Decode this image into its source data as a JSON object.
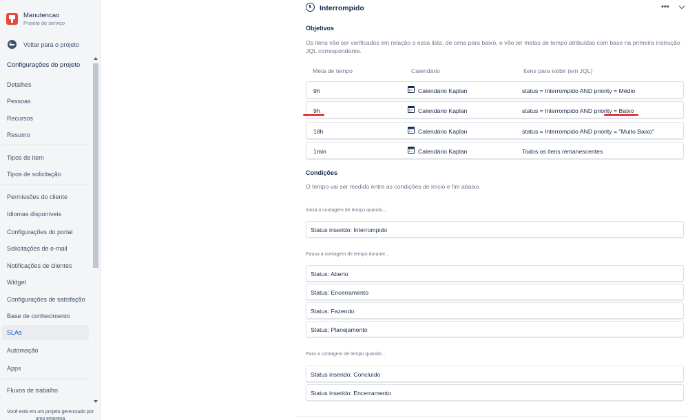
{
  "sidebar": {
    "project_name": "Manutencao",
    "project_type": "Projeto de serviço",
    "back_label": "Voltar para o projeto",
    "section_title": "Configurações do projeto",
    "items": [
      {
        "label": "Detalhes"
      },
      {
        "label": "Pessoas"
      },
      {
        "label": "Recursos"
      },
      {
        "label": "Resumo"
      },
      {
        "label": "Tipos de item"
      },
      {
        "label": "Tipos de solicitação"
      },
      {
        "label": "Permissões do cliente"
      },
      {
        "label": "Idiomas disponíveis"
      },
      {
        "label": "Configurações do portal"
      },
      {
        "label": "Solicitações de e-mail"
      },
      {
        "label": "Notificações de clientes"
      },
      {
        "label": "Widget"
      },
      {
        "label": "Configurações de satisfação"
      },
      {
        "label": "Base de conhecimento"
      },
      {
        "label": "SLAs"
      },
      {
        "label": "Automação"
      },
      {
        "label": "Apps"
      },
      {
        "label": "Fluxos de trabalho"
      }
    ],
    "selected": "SLAs",
    "footer": "Você está em um projeto gerenciado por uma empresa"
  },
  "sla": {
    "name": "Interrompido",
    "goals_title": "Objetivos",
    "goals_description": "Os itens vão ser verificados em relação a essa lista, de cima para baixo, e vão ter metas de tempo atribuídas com base na primeira instrução JQL correspondente.",
    "columns": {
      "goal": "Meta de tempo",
      "calendar": "Calendário",
      "jql": "Itens para exibir (em JQL)"
    },
    "goals": [
      {
        "goal": "9h",
        "calendar": "Calendário Kaplan",
        "jql": "status = Interrompido AND priority = Médio"
      },
      {
        "goal": "9h",
        "calendar": "Calendário Kaplan",
        "jql": "status = Interrompido AND priority = Baixo"
      },
      {
        "goal": "18h",
        "calendar": "Calendário Kaplan",
        "jql": "status = Interrompido AND priority = \"Muito Baixo\""
      },
      {
        "goal": "1min",
        "calendar": "Calendário Kaplan",
        "jql": "Todos os itens remanescentes"
      }
    ],
    "conditions_title": "Condições",
    "conditions_description": "O tempo vai ser medido entre as condições de início e fim abaixo.",
    "start_label": "Inicia a contagem de tempo quando...",
    "start": [
      "Status inserido: Interrompido"
    ],
    "pause_label": "Pausa a contagem de tempo durante...",
    "pause": [
      "Status: Aberto",
      "Status: Encerramento",
      "Status: Fazendo",
      "Status: Planejamento"
    ],
    "stop_label": "Para a contagem de tempo quando...",
    "stop": [
      "Status inserido: Concluído",
      "Status inserido: Encerramento"
    ]
  },
  "icons": {
    "project": "project-avatar-icon",
    "back": "arrow-left-icon",
    "sla": "clock-icon",
    "more": "more-icon",
    "expand": "chevron-down-icon",
    "calendar": "calendar-icon"
  },
  "colors": {
    "selected_text": "#0052cc",
    "annotation": "#e00000",
    "project_avatar": "#e5493a"
  }
}
